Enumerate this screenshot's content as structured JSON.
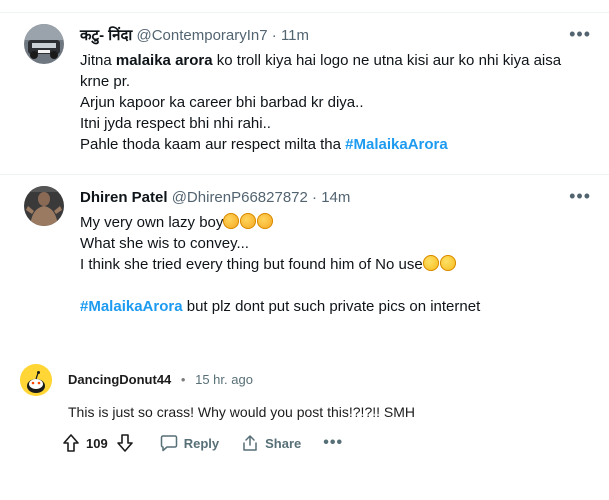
{
  "tweets": [
    {
      "name": "कटु- निंदा",
      "handle": "@ContemporaryIn7",
      "time": "11m",
      "lines": [
        {
          "pre": "Jitna ",
          "bold": "malaika arora",
          "post": " ko troll kiya hai logo ne utna kisi aur ko nhi kiya aisa"
        },
        {
          "text": "krne pr."
        },
        {
          "text": "Arjun kapoor ka career bhi barbad kr diya.."
        },
        {
          "text": "Itni jyda respect bhi nhi rahi.."
        },
        {
          "pre": "Pahle thoda kaam aur respect milta tha ",
          "hashtag": "#MalaikaArora"
        }
      ]
    },
    {
      "name": "Dhiren Patel",
      "handle": "@DhirenP66827872",
      "time": "14m",
      "lines": [
        {
          "text": "My very own lazy boy"
        },
        {
          "text": "What she wis to convey..."
        },
        {
          "text": "I think she tried every thing but found him of No use"
        },
        {
          "text": ""
        },
        {
          "hashtag": "#MalaikaArora",
          "post": " but plz dont put such private pics on internet"
        }
      ]
    }
  ],
  "reddit": {
    "username": "DancingDonut44",
    "separator": "•",
    "time": "15 hr. ago",
    "body": "This is just so crass! Why would you post this!?!?!! SMH",
    "votes": "109",
    "reply_label": "Reply",
    "share_label": "Share",
    "more_label": "•••"
  },
  "icons": {
    "more": "more-horizontal-icon",
    "upvote": "arrow-up-icon",
    "downvote": "arrow-down-icon",
    "reply": "comment-bubble-icon",
    "share": "share-icon"
  },
  "colors": {
    "hashtag": "#1d9bf0",
    "muted": "#536471",
    "reddit_avatar": "#ffd635"
  },
  "separator_dot": "·",
  "more_dots": "•••"
}
